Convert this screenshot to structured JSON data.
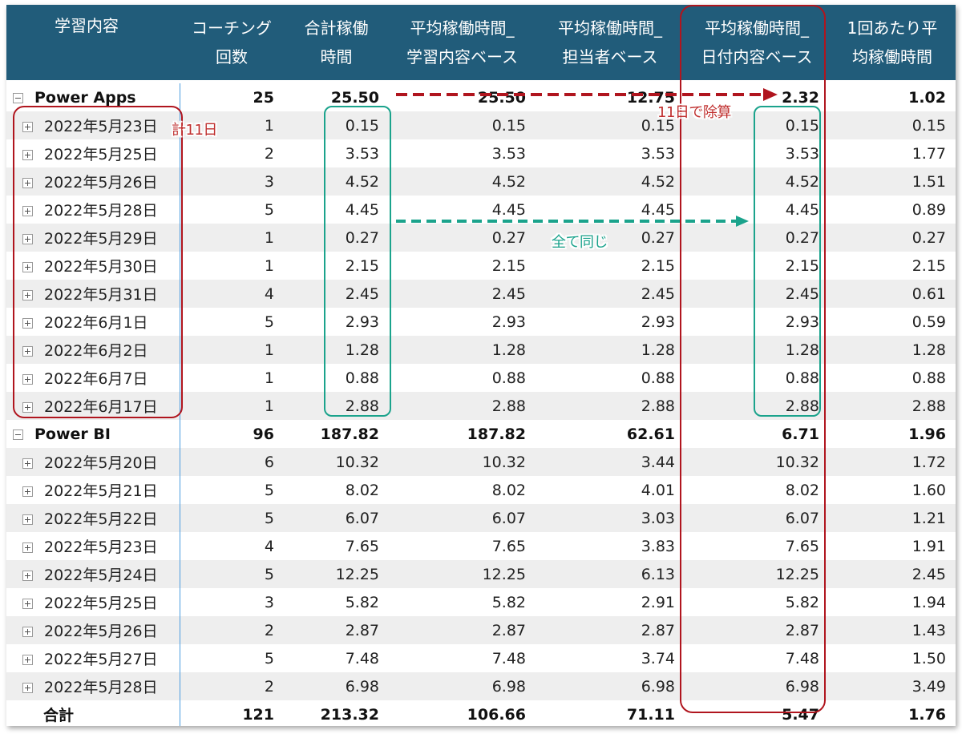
{
  "headers": [
    [
      "学習内容"
    ],
    [
      "コーチング",
      "回数"
    ],
    [
      "合計稼働",
      "時間"
    ],
    [
      "平均稼働時間_",
      "学習内容ベース"
    ],
    [
      "平均稼働時間_",
      "担当者ベース"
    ],
    [
      "平均稼働時間_",
      "日付内容ベース"
    ],
    [
      "1回あたり平",
      "均稼働時間"
    ]
  ],
  "groups": [
    {
      "label": "Power Apps",
      "values": [
        "25",
        "25.50",
        "25.50",
        "12.75",
        "2.32",
        "1.02"
      ],
      "rows": [
        {
          "label": "2022年5月23日",
          "values": [
            "1",
            "0.15",
            "0.15",
            "0.15",
            "0.15",
            "0.15"
          ]
        },
        {
          "label": "2022年5月25日",
          "values": [
            "2",
            "3.53",
            "3.53",
            "3.53",
            "3.53",
            "1.77"
          ]
        },
        {
          "label": "2022年5月26日",
          "values": [
            "3",
            "4.52",
            "4.52",
            "4.52",
            "4.52",
            "1.51"
          ]
        },
        {
          "label": "2022年5月28日",
          "values": [
            "5",
            "4.45",
            "4.45",
            "4.45",
            "4.45",
            "0.89"
          ]
        },
        {
          "label": "2022年5月29日",
          "values": [
            "1",
            "0.27",
            "0.27",
            "0.27",
            "0.27",
            "0.27"
          ]
        },
        {
          "label": "2022年5月30日",
          "values": [
            "1",
            "2.15",
            "2.15",
            "2.15",
            "2.15",
            "2.15"
          ]
        },
        {
          "label": "2022年5月31日",
          "values": [
            "4",
            "2.45",
            "2.45",
            "2.45",
            "2.45",
            "0.61"
          ]
        },
        {
          "label": "2022年6月1日",
          "values": [
            "5",
            "2.93",
            "2.93",
            "2.93",
            "2.93",
            "0.59"
          ]
        },
        {
          "label": "2022年6月2日",
          "values": [
            "1",
            "1.28",
            "1.28",
            "1.28",
            "1.28",
            "1.28"
          ]
        },
        {
          "label": "2022年6月7日",
          "values": [
            "1",
            "0.88",
            "0.88",
            "0.88",
            "0.88",
            "0.88"
          ]
        },
        {
          "label": "2022年6月17日",
          "values": [
            "1",
            "2.88",
            "2.88",
            "2.88",
            "2.88",
            "2.88"
          ]
        }
      ]
    },
    {
      "label": "Power BI",
      "values": [
        "96",
        "187.82",
        "187.82",
        "62.61",
        "6.71",
        "1.96"
      ],
      "rows": [
        {
          "label": "2022年5月20日",
          "values": [
            "6",
            "10.32",
            "10.32",
            "3.44",
            "10.32",
            "1.72"
          ]
        },
        {
          "label": "2022年5月21日",
          "values": [
            "5",
            "8.02",
            "8.02",
            "4.01",
            "8.02",
            "1.60"
          ]
        },
        {
          "label": "2022年5月22日",
          "values": [
            "5",
            "6.07",
            "6.07",
            "3.03",
            "6.07",
            "1.21"
          ]
        },
        {
          "label": "2022年5月23日",
          "values": [
            "4",
            "7.65",
            "7.65",
            "3.83",
            "7.65",
            "1.91"
          ]
        },
        {
          "label": "2022年5月24日",
          "values": [
            "5",
            "12.25",
            "12.25",
            "6.13",
            "12.25",
            "2.45"
          ]
        },
        {
          "label": "2022年5月25日",
          "values": [
            "3",
            "5.82",
            "5.82",
            "2.91",
            "5.82",
            "1.94"
          ]
        },
        {
          "label": "2022年5月26日",
          "values": [
            "2",
            "2.87",
            "2.87",
            "2.87",
            "2.87",
            "1.43"
          ]
        },
        {
          "label": "2022年5月27日",
          "values": [
            "5",
            "7.48",
            "7.48",
            "3.74",
            "7.48",
            "1.50"
          ]
        },
        {
          "label": "2022年5月28日",
          "values": [
            "2",
            "6.98",
            "6.98",
            "6.98",
            "6.98",
            "3.49"
          ]
        }
      ]
    }
  ],
  "total": {
    "label": "合計",
    "values": [
      "121",
      "213.32",
      "106.66",
      "71.11",
      "5.47",
      "1.76"
    ]
  },
  "annotations": {
    "count_note": "計11日",
    "divide_note": "11日で除算",
    "same_note": "全て同じ"
  },
  "colors": {
    "header_bg": "#215c7a",
    "red": "#b0151e",
    "teal": "#1ba38c"
  }
}
